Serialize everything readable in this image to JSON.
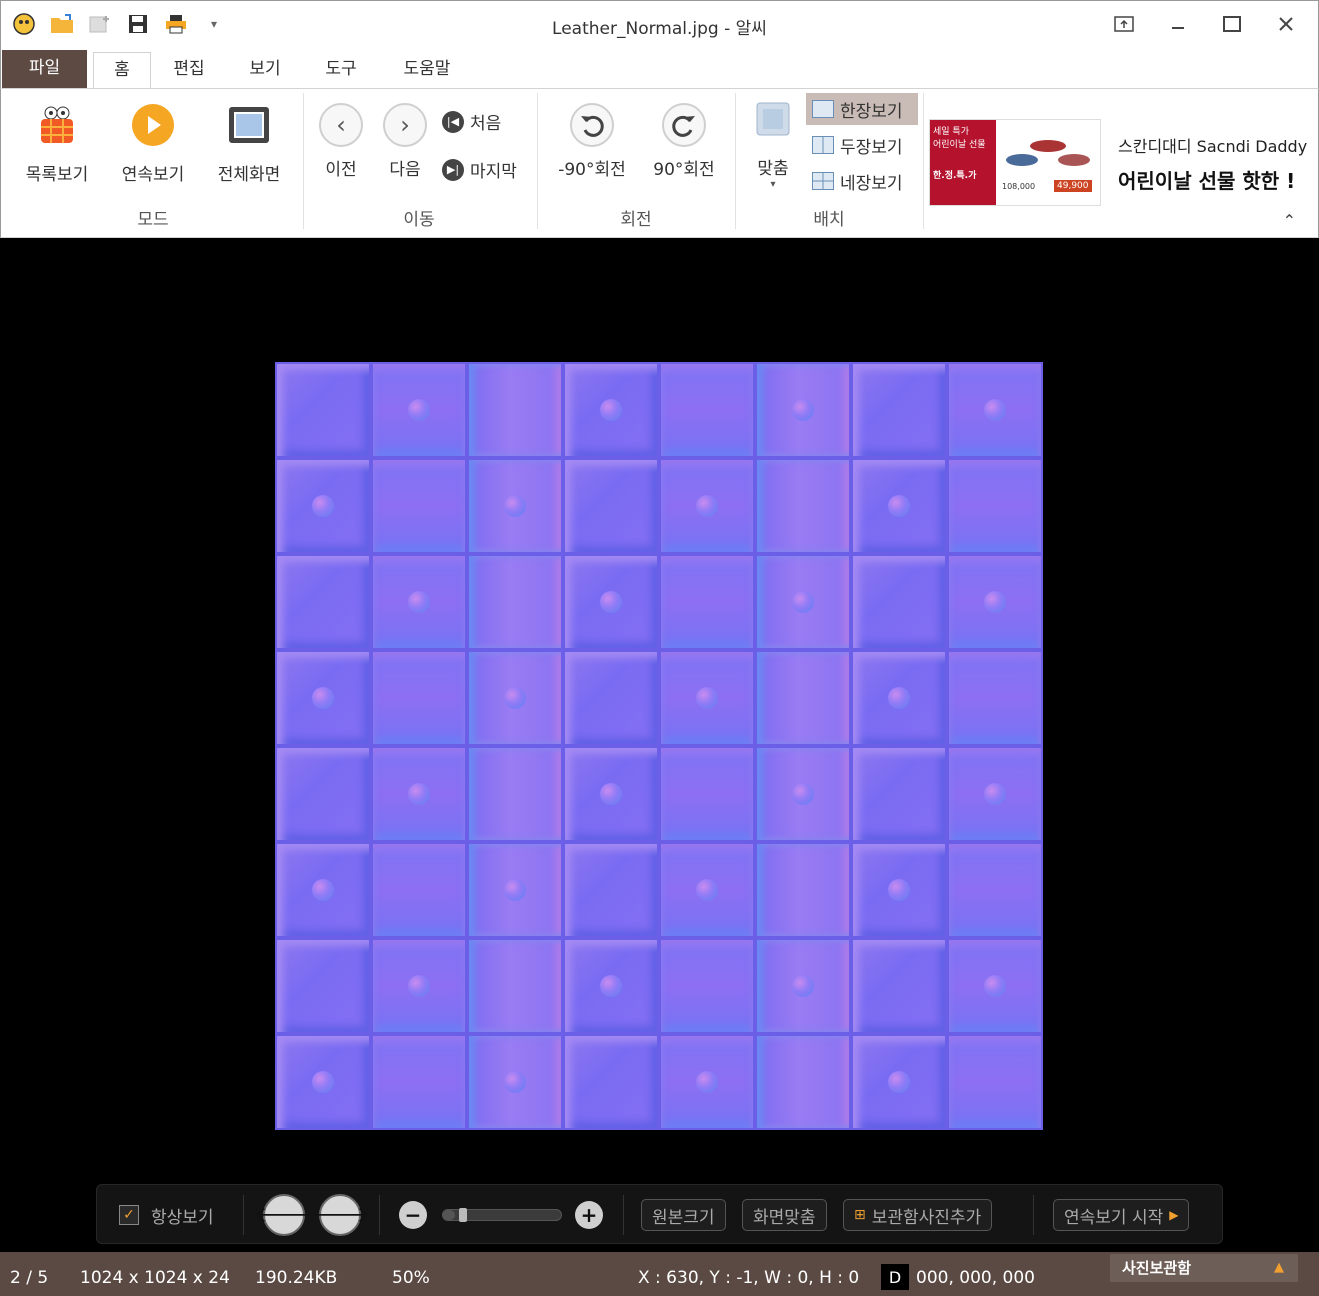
{
  "window": {
    "title": "Leather_Normal.jpg - 알씨",
    "controls": [
      "pin-icon",
      "minimize-icon",
      "maximize-icon",
      "close-icon"
    ]
  },
  "quick_access": [
    "app-logo-icon",
    "open-folder-icon",
    "new-icon",
    "save-icon",
    "print-icon",
    "customize-dropdown-icon"
  ],
  "tabs": {
    "file": "파일",
    "home": "홈",
    "edit": "편집",
    "view": "보기",
    "tools": "도구",
    "help": "도움말"
  },
  "ribbon": {
    "mode": {
      "group_label": "모드",
      "list_view": "목록보기",
      "slideshow": "연속보기",
      "fullscreen": "전체화면"
    },
    "navigate": {
      "group_label": "이동",
      "prev": "이전",
      "next": "다음",
      "first": "처음",
      "last": "마지막"
    },
    "rotate": {
      "group_label": "회전",
      "ccw": "-90°회전",
      "cw": "90°회전"
    },
    "layout": {
      "group_label": "배치",
      "fit": "맞춤",
      "single": "한장보기",
      "double": "두장보기",
      "quad": "네장보기"
    },
    "ad": {
      "brand": "스칸디대디 Sacndi Daddy",
      "headline": "어린이날 선물 핫한 !",
      "banner_lines": [
        "세일 특가",
        "어린이날 선물",
        "한.정.특.가"
      ],
      "price_old": "108,000",
      "price_new": "49,900"
    }
  },
  "toolbar": {
    "always_show": "항상보기",
    "always_show_checked": true,
    "original_size": "원본크기",
    "fit_screen": "화면맞춤",
    "add_to_album": "보관함사진추가",
    "start_slideshow": "연속보기 시작",
    "zoom_level": 0.1
  },
  "status": {
    "position": "2 / 5",
    "dimensions": "1024 x 1024 x 24",
    "filesize": "190.24KB",
    "zoom": "50%",
    "coords": "X : 630, Y : -1, W : 0, H : 0",
    "color_mode": "D",
    "color_value": "000, 000, 000",
    "album_label": "사진보관함"
  },
  "colors": {
    "accent_brown": "#5b4a44",
    "orange": "#f5a623",
    "normal_map_base": "#8070f2"
  }
}
